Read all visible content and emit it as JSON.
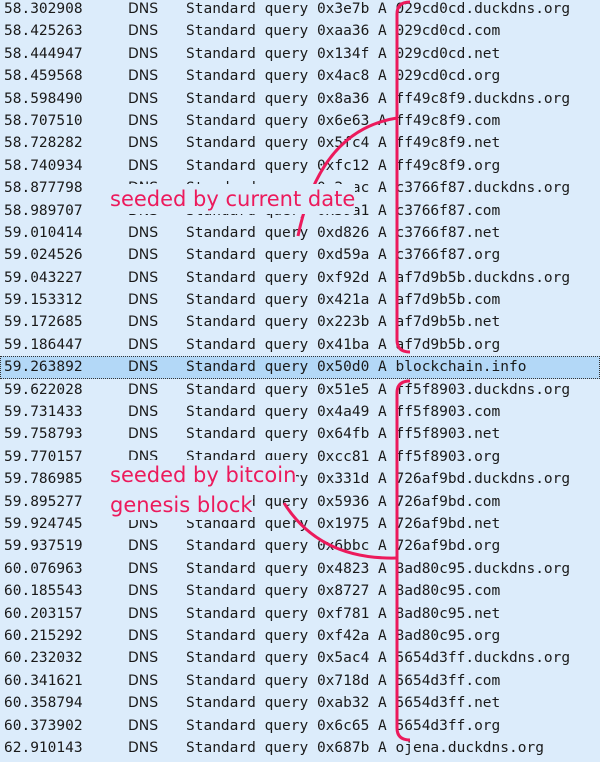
{
  "packets": [
    {
      "time": "58.302908",
      "proto": "DNS",
      "info": "Standard query 0x3e7b A 029cd0cd.duckdns.org"
    },
    {
      "time": "58.425263",
      "proto": "DNS",
      "info": "Standard query 0xaa36 A 029cd0cd.com"
    },
    {
      "time": "58.444947",
      "proto": "DNS",
      "info": "Standard query 0x134f A 029cd0cd.net"
    },
    {
      "time": "58.459568",
      "proto": "DNS",
      "info": "Standard query 0x4ac8 A 029cd0cd.org"
    },
    {
      "time": "58.598490",
      "proto": "DNS",
      "info": "Standard query 0x8a36 A ff49c8f9.duckdns.org"
    },
    {
      "time": "58.707510",
      "proto": "DNS",
      "info": "Standard query 0x6e63 A ff49c8f9.com"
    },
    {
      "time": "58.728282",
      "proto": "DNS",
      "info": "Standard query 0x5fc4 A ff49c8f9.net"
    },
    {
      "time": "58.740934",
      "proto": "DNS",
      "info": "Standard query 0xfc12 A ff49c8f9.org"
    },
    {
      "time": "58.877798",
      "proto": "DNS",
      "info": "Standard query 0x2eac A c3766f87.duckdns.org"
    },
    {
      "time": "58.989707",
      "proto": "DNS",
      "info": "Standard query 0x39a1 A c3766f87.com"
    },
    {
      "time": "59.010414",
      "proto": "DNS",
      "info": "Standard query 0xd826 A c3766f87.net"
    },
    {
      "time": "59.024526",
      "proto": "DNS",
      "info": "Standard query 0xd59a A c3766f87.org"
    },
    {
      "time": "59.043227",
      "proto": "DNS",
      "info": "Standard query 0xf92d A af7d9b5b.duckdns.org"
    },
    {
      "time": "59.153312",
      "proto": "DNS",
      "info": "Standard query 0x421a A af7d9b5b.com"
    },
    {
      "time": "59.172685",
      "proto": "DNS",
      "info": "Standard query 0x223b A af7d9b5b.net"
    },
    {
      "time": "59.186447",
      "proto": "DNS",
      "info": "Standard query 0x41ba A af7d9b5b.org"
    },
    {
      "time": "59.263892",
      "proto": "DNS",
      "info": "Standard query 0x50d0 A blockchain.info",
      "selected": true
    },
    {
      "time": "59.622028",
      "proto": "DNS",
      "info": "Standard query 0x51e5 A ff5f8903.duckdns.org"
    },
    {
      "time": "59.731433",
      "proto": "DNS",
      "info": "Standard query 0x4a49 A ff5f8903.com"
    },
    {
      "time": "59.758793",
      "proto": "DNS",
      "info": "Standard query 0x64fb A ff5f8903.net"
    },
    {
      "time": "59.770157",
      "proto": "DNS",
      "info": "Standard query 0xcc81 A ff5f8903.org"
    },
    {
      "time": "59.786985",
      "proto": "DNS",
      "info": "Standard query 0x331d A 726af9bd.duckdns.org"
    },
    {
      "time": "59.895277",
      "proto": "DNS",
      "info": "Standard query 0x5936 A 726af9bd.com"
    },
    {
      "time": "59.924745",
      "proto": "DNS",
      "info": "Standard query 0x1975 A 726af9bd.net"
    },
    {
      "time": "59.937519",
      "proto": "DNS",
      "info": "Standard query 0x6bbc A 726af9bd.org"
    },
    {
      "time": "60.076963",
      "proto": "DNS",
      "info": "Standard query 0x4823 A 8ad80c95.duckdns.org"
    },
    {
      "time": "60.185543",
      "proto": "DNS",
      "info": "Standard query 0x8727 A 8ad80c95.com"
    },
    {
      "time": "60.203157",
      "proto": "DNS",
      "info": "Standard query 0xf781 A 8ad80c95.net"
    },
    {
      "time": "60.215292",
      "proto": "DNS",
      "info": "Standard query 0xf42a A 8ad80c95.org"
    },
    {
      "time": "60.232032",
      "proto": "DNS",
      "info": "Standard query 0x5ac4 A 5654d3ff.duckdns.org"
    },
    {
      "time": "60.341621",
      "proto": "DNS",
      "info": "Standard query 0x718d A 5654d3ff.com"
    },
    {
      "time": "60.358794",
      "proto": "DNS",
      "info": "Standard query 0xab32 A 5654d3ff.net"
    },
    {
      "time": "60.373902",
      "proto": "DNS",
      "info": "Standard query 0x6c65 A 5654d3ff.org"
    },
    {
      "time": "62.910143",
      "proto": "DNS",
      "info": "Standard query 0x687b A ojena.duckdns.org"
    }
  ],
  "annotations": {
    "date": "seeded by current date",
    "genesis_line1": "seeded by bitcoin",
    "genesis_line2": "genesis block"
  },
  "colors": {
    "background": "#dcecfb",
    "selected": "#b3d8f7",
    "annotation": "#ec1a5c"
  }
}
